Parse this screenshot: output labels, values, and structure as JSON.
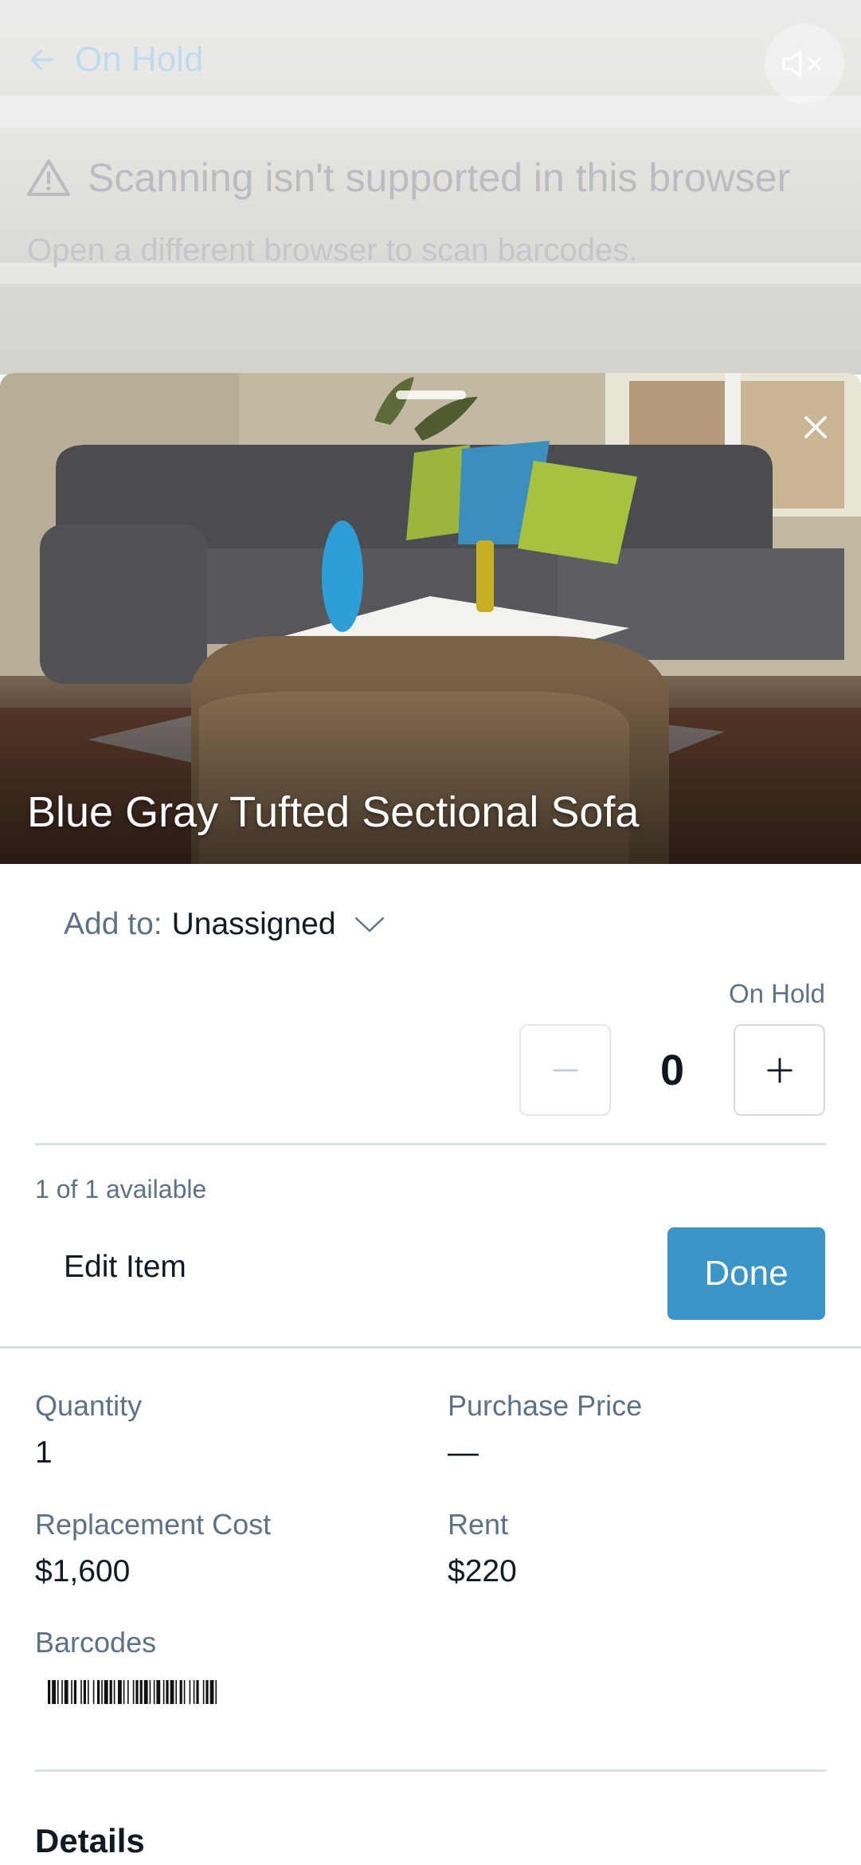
{
  "background": {
    "back_label": "On Hold",
    "warning_title": "Scanning isn't supported in this browser",
    "warning_subtitle": "Open a different browser to scan barcodes."
  },
  "item": {
    "title": "Blue Gray Tufted Sectional Sofa",
    "add_to_label": "Add to:",
    "add_to_value": "Unassigned",
    "status_label": "On Hold",
    "count": "0",
    "availability": "1 of 1 available",
    "edit_label": "Edit Item",
    "done_label": "Done"
  },
  "fields": {
    "quantity_label": "Quantity",
    "quantity_value": "1",
    "purchase_price_label": "Purchase Price",
    "purchase_price_value": "—",
    "replacement_cost_label": "Replacement Cost",
    "replacement_cost_value": "$1,600",
    "rent_label": "Rent",
    "rent_value": "$220",
    "barcodes_label": "Barcodes"
  },
  "details_heading": "Details",
  "colors": {
    "accent": "#3a96c8",
    "label_text": "#5d7287",
    "value_text": "#111a24"
  }
}
